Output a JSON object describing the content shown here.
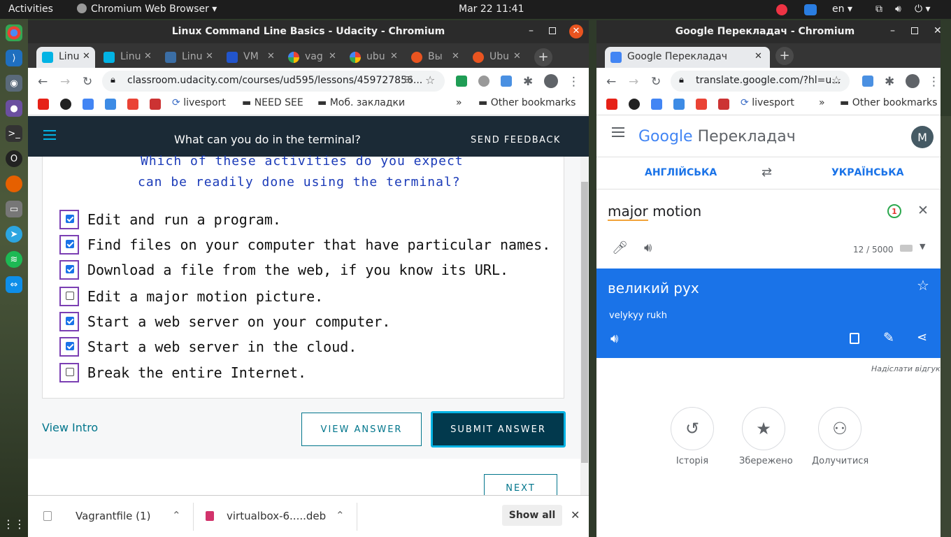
{
  "topbar": {
    "activities": "Activities",
    "app": "Chromium Web Browser",
    "datetime": "Mar 22  11:41",
    "lang": "en"
  },
  "left_window": {
    "title": "Linux Command Line Basics - Udacity - Chromium",
    "tabs": [
      {
        "label": "Linu"
      },
      {
        "label": "Linu"
      },
      {
        "label": "Linu"
      },
      {
        "label": "VM"
      },
      {
        "label": "vag"
      },
      {
        "label": "ubu"
      },
      {
        "label": "Вы"
      },
      {
        "label": "Ubu"
      }
    ],
    "url": "classroom.udacity.com/courses/ud595/lessons/459727856...",
    "bookmarks": [
      "livesport",
      "NEED SEE",
      "Моб. закладки",
      "Other bookmarks"
    ],
    "udacity": {
      "header_title": "What can you do in the terminal?",
      "send_feedback": "SEND FEEDBACK",
      "question_line1": "Which of these activities do you expect",
      "question_line2": "can be readily done using the terminal?",
      "options": [
        {
          "label": "Edit and run a program.",
          "checked": true
        },
        {
          "label": "Find files on your computer that have particular names.",
          "checked": true
        },
        {
          "label": "Download a file from the web, if you know its URL.",
          "checked": true
        },
        {
          "label": "Edit a major motion picture.",
          "checked": false
        },
        {
          "label": "Start a web server on your computer.",
          "checked": true
        },
        {
          "label": "Start a web server in the cloud.",
          "checked": true
        },
        {
          "label": "Break the entire Internet.",
          "checked": false
        }
      ],
      "view_intro": "View Intro",
      "view_answer": "VIEW ANSWER",
      "submit_answer": "SUBMIT ANSWER",
      "next": "NEXT"
    },
    "downloads": {
      "item1": "Vagrantfile (1)",
      "item2": "virtualbox-6.....deb",
      "show_all": "Show all"
    }
  },
  "right_window": {
    "title": "Google Перекладач - Chromium",
    "tab_label": "Google Перекладач",
    "url": "translate.google.com/?hl=u...",
    "bookmarks": [
      "livesport",
      "Other bookmarks"
    ],
    "translate": {
      "logo_google": "Google",
      "logo_suffix": "Перекладач",
      "avatar": "M",
      "source_lang": "АНГЛІЙСЬКА",
      "target_lang": "УКРАЇНСЬКА",
      "input_word1": "major",
      "input_word2": " motion",
      "badge": "1",
      "char_count": "12 / 5000",
      "result": "великий рух",
      "translit": "velykyy rukh",
      "feedback": "Надіслати відгук",
      "actions": [
        {
          "label": "Історія"
        },
        {
          "label": "Збережено"
        },
        {
          "label": "Долучитися"
        }
      ]
    }
  },
  "colors": {
    "udacity_dark": "#1b2a36",
    "submit": "#02394d",
    "teal": "#02b3e4",
    "google_blue": "#1a73e8"
  }
}
